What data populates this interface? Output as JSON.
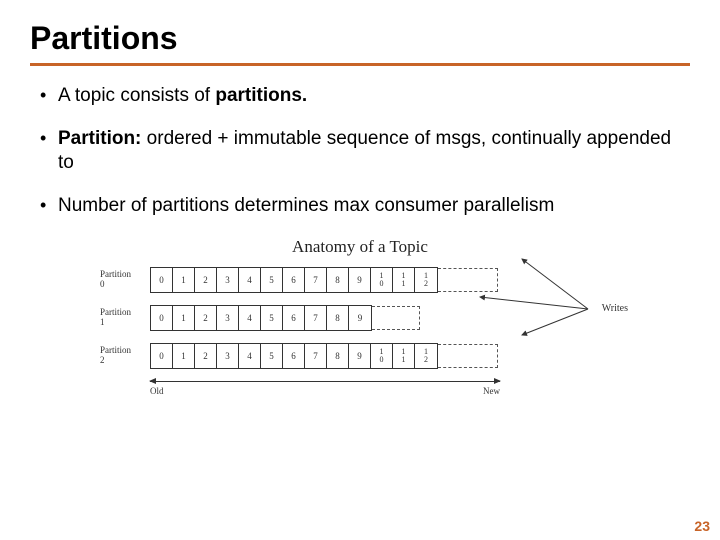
{
  "title": "Partitions",
  "bullets": [
    {
      "pre": "A topic consists of ",
      "bold": "partitions.",
      "post": ""
    },
    {
      "pre": "",
      "bold": "Partition:",
      "post": "  ordered + immutable sequence of msgs, continually appended to"
    },
    {
      "pre": "Number of partitions determines max consumer parallelism",
      "bold": "",
      "post": ""
    }
  ],
  "diagram": {
    "title": "Anatomy of a Topic",
    "partitions": [
      {
        "label_top": "Partition",
        "label_bot": "0",
        "cells": [
          "0",
          "1",
          "2",
          "3",
          "4",
          "5",
          "6",
          "7",
          "8",
          "9",
          "1\n0",
          "1\n1",
          "1\n2"
        ],
        "dashed": true,
        "dashed_short": false
      },
      {
        "label_top": "Partition",
        "label_bot": "1",
        "cells": [
          "0",
          "1",
          "2",
          "3",
          "4",
          "5",
          "6",
          "7",
          "8",
          "9"
        ],
        "dashed": true,
        "dashed_short": true
      },
      {
        "label_top": "Partition",
        "label_bot": "2",
        "cells": [
          "0",
          "1",
          "2",
          "3",
          "4",
          "5",
          "6",
          "7",
          "8",
          "9",
          "1\n0",
          "1\n1",
          "1\n2"
        ],
        "dashed": true,
        "dashed_short": false
      }
    ],
    "old": "Old",
    "new": "New",
    "writes": "Writes"
  },
  "page": "23"
}
